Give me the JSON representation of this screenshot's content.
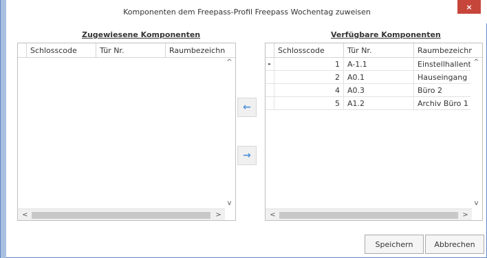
{
  "window": {
    "title": "Komponenten dem Freepass-Profil Freepass Wochentag zuweisen",
    "close_label": "×"
  },
  "assigned": {
    "title": "Zugewiesene Komponenten",
    "columns": [
      "Schlosscode",
      "Tür Nr.",
      "Raumbezeichnung"
    ],
    "rows": []
  },
  "available": {
    "title": "Verfügbare Komponenten",
    "columns": [
      "Schlosscode",
      "Tür Nr.",
      "Raumbezeichnung"
    ],
    "rows": [
      {
        "code": "1",
        "door": "A-1.1",
        "room": "Einstellhallentor S"
      },
      {
        "code": "2",
        "door": "A0.1",
        "room": "Hauseingang"
      },
      {
        "code": "4",
        "door": "A0.3",
        "room": "Büro 2"
      },
      {
        "code": "5",
        "door": "A1.2",
        "room": "Archiv Büro 1"
      }
    ],
    "selected_row_marker": "▸"
  },
  "transfer": {
    "assign_icon": "←",
    "remove_icon": "→"
  },
  "scroll": {
    "up": "^",
    "down": "v",
    "left": "<",
    "right": ">"
  },
  "buttons": {
    "save": "Speichern",
    "cancel": "Abbrechen"
  }
}
